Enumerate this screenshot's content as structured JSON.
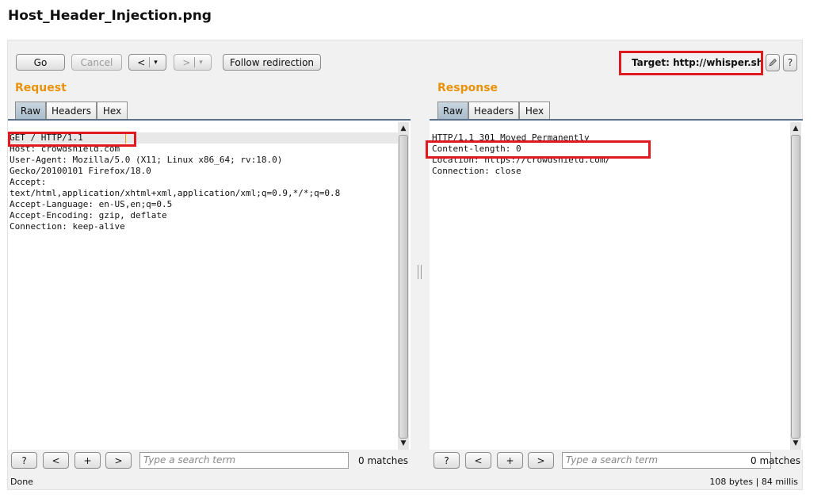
{
  "file_title": "Host_Header_Injection.png",
  "toolbar": {
    "go_label": "Go",
    "cancel_label": "Cancel",
    "back_label": "<",
    "forward_label": ">",
    "dropdown_glyph": "▾",
    "follow_label": "Follow redirection",
    "target_label": "Target: http://whisper.sh",
    "edit_icon": "pencil-icon",
    "help_label": "?"
  },
  "request": {
    "title": "Request",
    "tabs": [
      "Raw",
      "Headers",
      "Hex"
    ],
    "active_tab": "Raw",
    "lines": [
      "GET / HTTP/1.1",
      "Host: crowdshield.com",
      "User-Agent: Mozilla/5.0 (X11; Linux x86_64; rv:18.0)",
      "Gecko/20100101 Firefox/18.0",
      "Accept:",
      "text/html,application/xhtml+xml,application/xml;q=0.9,*/*;q=0.8",
      "Accept-Language: en-US,en;q=0.5",
      "Accept-Encoding: gzip, deflate",
      "Connection: keep-alive"
    ],
    "search": {
      "help_label": "?",
      "prev_label": "<",
      "add_label": "+",
      "next_label": ">",
      "placeholder": "Type a search term",
      "matches": "0 matches"
    },
    "status": "Done"
  },
  "response": {
    "title": "Response",
    "tabs": [
      "Raw",
      "Headers",
      "Hex"
    ],
    "active_tab": "Raw",
    "lines": [
      "HTTP/1.1 301 Moved Permanently",
      "Content-length: 0",
      "Location: https://crowdshield.com/",
      "Connection: close"
    ],
    "search": {
      "help_label": "?",
      "prev_label": "<",
      "add_label": "+",
      "next_label": ">",
      "placeholder": "Type a search term",
      "matches": "0 matches"
    },
    "status": "108 bytes | 84 millis"
  },
  "colors": {
    "section_title": "#e8920a",
    "annotation_box": "#e0181f",
    "active_tab": "#b4c5d2"
  }
}
